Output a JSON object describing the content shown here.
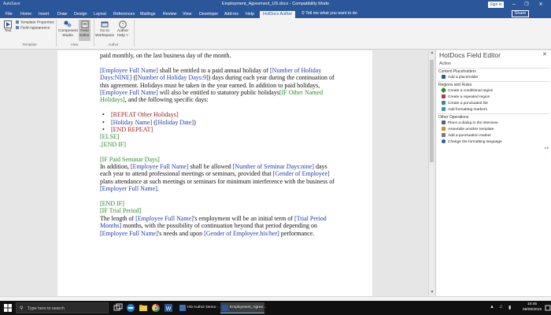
{
  "window": {
    "qat_label": "AutoSave",
    "title": "Employment_Agreement_US.docx  -  Compatibility Mode",
    "signin_label": "Sign in",
    "minimize_glyph": "–",
    "restore_glyph": "❐",
    "close_glyph": "✕"
  },
  "ribbon_tabs": {
    "file": "File",
    "home": "Home",
    "insert": "Insert",
    "draw": "Draw",
    "design": "Design",
    "layout": "Layout",
    "references": "References",
    "mailings": "Mailings",
    "review": "Review",
    "view": "View",
    "developer": "Developer",
    "addins": "Add-ins",
    "help": "Help",
    "hotdocs": "HotDocs Author",
    "tell_me": "Tell me what you want to do",
    "share": "Share"
  },
  "ribbon": {
    "test": "Test",
    "template_properties": "Template Properties",
    "field_appearance": "Field Appearance",
    "template_group": "Template",
    "component_studio_1": "Component",
    "component_studio_2": "Studio",
    "field_editor_1": "Field",
    "field_editor_2": "Editor",
    "view_group": "View",
    "go_to_workspace_1": "Go to",
    "go_to_workspace_2": "Workspace",
    "author_help_1": "Author",
    "author_help_2": "Help ˅",
    "author_group": "Author"
  },
  "document": {
    "l1": "paid monthly, on the last business day of the month.",
    "p2_f1": "[Employee Full Name]",
    "p2_t1": " shall be entitled to a paid annual holiday of ",
    "p2_f2": "[Number of Holiday Days:NINE]",
    "p2_t2": " ([",
    "p2_f3": "Number of Holiday Days:9",
    "p2_t3": "]) days during each year during the continuation of this agreement. Holidays must be taken in the year earned. In addition to paid holidays, ",
    "p2_f4": "[Employee Full Name]",
    "p2_t4": " will also be entitled to statutory public holidays",
    "p2_c1": "[IF Other Named Holidays]",
    "p2_t5": ", and the following specific days:",
    "b1": "[REPEAT Other Holidays]",
    "b2_f1": "[Holiday Name]",
    "b2_t1": " (",
    "b2_f2": "[Holiday Date]",
    "b2_t2": ")",
    "b3": "[END REPEAT]",
    "else": "[ELSE]",
    "endif_1_prefix": ".",
    "endif_1": "[END IF]",
    "if_seminar": "[IF Paid Seminar Days]",
    "p4_t1": "In addition, ",
    "p4_f1": "[Employee Full Name]",
    "p4_t2": " shall be allowed ",
    "p4_f2": "[Number of Seminar Days:nine]",
    "p4_t3": " days each year to attend professional meetings or seminars, provided that ",
    "p4_f3": "[Gender of Employee]",
    "p4_t4": " plans attendance at such meetings or seminars for minimum interference with the business of ",
    "p4_f4": "[Employer Full Name]",
    "p4_t5": ".",
    "endif_2": "[END IF]",
    "if_trial": "[IF Trial Period]",
    "p5_t1": "The length of ",
    "p5_f1": "[Employee Full Name]",
    "p5_t2": "'s employment will be an initial term of ",
    "p5_f2": "[Trial Period Months]",
    "p5_t3": " months, with the possibility of continuation beyond that period depending on ",
    "p5_f3": "[Employee Full Name]",
    "p5_t4": "'s needs and upon ",
    "p5_f4": "[Gender of Employee.his/her]",
    "p5_t5": " performance."
  },
  "pane": {
    "title": "HotDocs Field Editor",
    "close_glyph": "✕",
    "action": "Action",
    "content_placeholders": "Content Placeholders",
    "add_placeholder": "Add a placeholder",
    "regions_rules": "Regions and Rules",
    "create_conditional": "Create a conditional region",
    "create_repeated": "Create a repeated region",
    "create_punctuated": "Create a punctuated list",
    "add_formatting": "Add formatting markers",
    "other_operations": "Other Operations",
    "place_dialog": "Place a dialog in the interview",
    "assemble_another": "Assemble another template",
    "add_punctuation": "Add a punctuation marker",
    "change_language": "Change the formatting language",
    "more_link": "Le"
  },
  "taskbar": {
    "search_placeholder": "Type here to search",
    "app_hd": "HD Author Demo - ...",
    "app_word": "Employment_Agree...",
    "time": "10:45",
    "date": "08/08/2019"
  },
  "colors": {
    "word_blue": "#2b579a",
    "field_blue": "#1f3aa8",
    "condition_green": "#2c8a2c",
    "repeat_red": "#a02020"
  }
}
